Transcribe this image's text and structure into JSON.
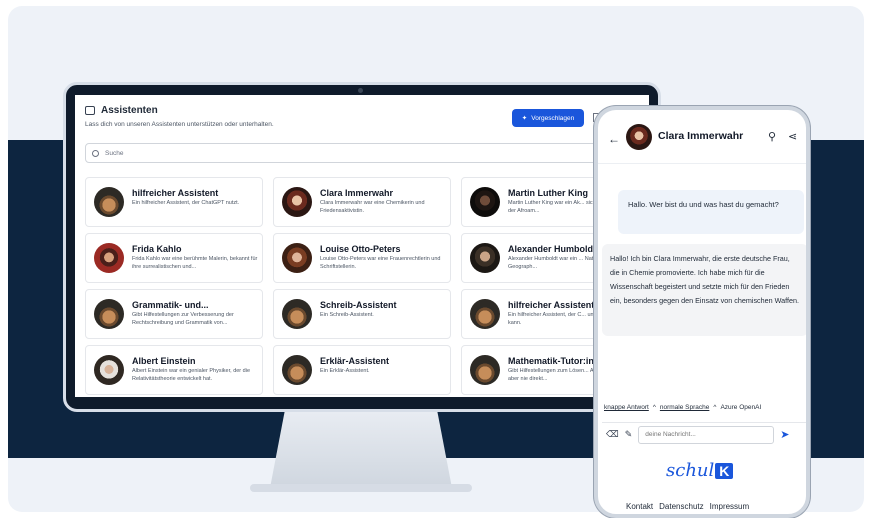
{
  "assistants_page": {
    "title": "Assistenten",
    "subtitle": "Lass dich von unseren Assistenten unterstützen oder unterhalten.",
    "suggest_button": "Vorgeschlagen",
    "search_placeholder": "Suche",
    "cards": [
      {
        "name": "hilfreicher Assistent",
        "desc": "Ein hilfreicher Assistent, der ChatGPT nutzt.",
        "avatar": "robot"
      },
      {
        "name": "Clara Immerwahr",
        "desc": "Clara Immerwahr war eine Chemikerin und Friedensaktivistin.",
        "avatar": "clara"
      },
      {
        "name": "Martin Luther King",
        "desc": "Martin Luther King war ein Ak... sich für die Rechte der Afroam...",
        "avatar": "luther"
      },
      {
        "name": "Frida Kahlo",
        "desc": "Frida Kahlo war eine berühmte Malerin, bekannt für ihre surrealistischen und...",
        "avatar": "frida"
      },
      {
        "name": "Louise Otto-Peters",
        "desc": "Louise Otto-Peters war eine Frauenrechtlerin und Schriftstellerin.",
        "avatar": "louise"
      },
      {
        "name": "Alexander Humboldt",
        "desc": "Alexander Humboldt war ein ... Naturforscher und Geograph...",
        "avatar": "humb"
      },
      {
        "name": "Grammatik- und...",
        "desc": "Gibt Hilfestellungen zur Verbesserung der Rechtschreibung und Grammatik von...",
        "avatar": "robot"
      },
      {
        "name": "Schreib-Assistent",
        "desc": "Ein Schreib-Assistent.",
        "avatar": "robot"
      },
      {
        "name": "hilfreicher Assistent",
        "desc": "Ein hilfreicher Assistent, der C... und Links folgen kann.",
        "avatar": "robot"
      },
      {
        "name": "Albert Einstein",
        "desc": "Albert Einstein war ein genialer Physiker, der die Relativitätstheorie entwickelt hat.",
        "avatar": "einstein"
      },
      {
        "name": "Erklär-Assistent",
        "desc": "Ein Erklär-Assistent.",
        "avatar": "robot"
      },
      {
        "name": "Mathematik-Tutor:in",
        "desc": "Gibt Hilfestellungen zum Lösen... Aufgaben. Gibt aber nie direkt...",
        "avatar": "robot"
      }
    ]
  },
  "chat": {
    "back_icon": "arrow-left-icon",
    "contact_name": "Clara Immerwahr",
    "pin_icon": "pin-icon",
    "share_icon": "share-icon",
    "user_message": "Hallo. Wer bist du und was hast du gemacht?",
    "bot_message": "Hallo! Ich bin Clara Immerwahr, die erste deutsche Frau, die in Chemie promovierte. Ich habe mich für die Wissenschaft begeistert und setzte mich für den Frieden ein, besonders gegen den Einsatz von chemischen Waffen.",
    "option_length": "knappe Antwort",
    "option_language": "normale Sprache",
    "model": "Azure OpenAI",
    "input_placeholder": "deine Nachricht...",
    "logo_text": "schul",
    "logo_mark": "K",
    "footer": [
      "Kontakt",
      "Datenschutz",
      "Impressum"
    ]
  }
}
